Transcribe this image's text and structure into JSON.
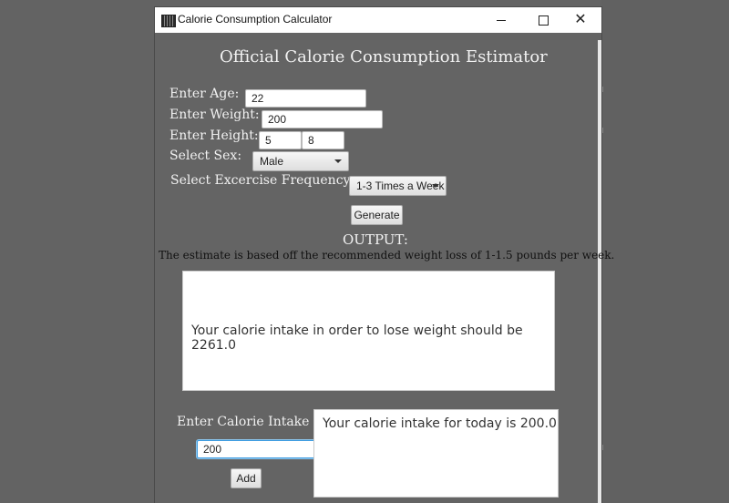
{
  "window": {
    "title": "Calorie Consumption Calculator"
  },
  "header": {
    "title": "Official Calorie Consumption Estimator"
  },
  "form": {
    "age_label": "Enter Age:",
    "age_value": "22",
    "weight_label": "Enter Weight:",
    "weight_value": "200",
    "height_label": "Enter Height:",
    "height_feet": "5",
    "height_inches": "8",
    "sex_label": "Select Sex:",
    "sex_value": "Male",
    "frequency_label": "Select Excercise Frequency:",
    "frequency_value": "1-3 Times a Week",
    "generate_label": "Generate"
  },
  "output": {
    "heading": "OUTPUT:",
    "note": "The estimate is based off the recommended weight loss of 1-1.5 pounds per week.",
    "result": "Your calorie intake in order to lose weight should be 2261.0"
  },
  "intake": {
    "label": "Enter Calorie Intake",
    "value": "200",
    "add_label": "Add",
    "result": "Your calorie intake for today is 200.0"
  }
}
